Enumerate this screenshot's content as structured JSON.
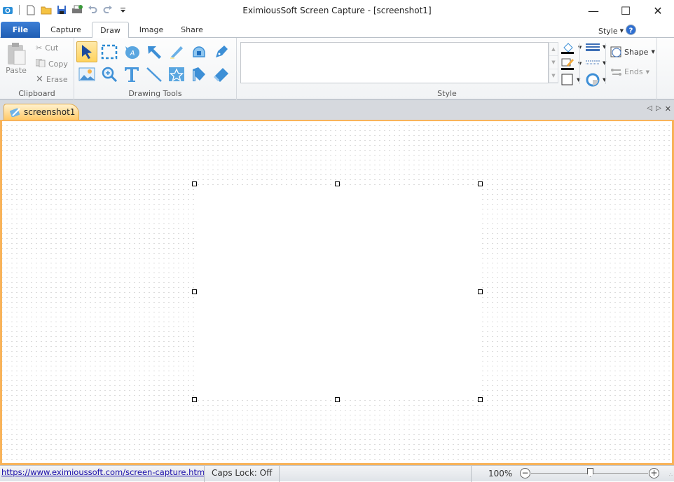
{
  "window": {
    "title": "EximiousSoft Screen Capture - [screenshot1]",
    "controls": [
      "minimize",
      "maximize",
      "close"
    ]
  },
  "quick_access": [
    "camera-icon",
    "new-icon",
    "open-icon",
    "save-icon",
    "print-icon",
    "undo-icon",
    "redo-icon",
    "customize-icon"
  ],
  "menu_tabs": [
    {
      "label": "File",
      "active": false
    },
    {
      "label": "Capture",
      "active": false
    },
    {
      "label": "Draw",
      "active": true
    },
    {
      "label": "Image",
      "active": false
    },
    {
      "label": "Share",
      "active": false
    }
  ],
  "style_menu": {
    "label": "Style"
  },
  "ribbon": {
    "clipboard": {
      "label": "Clipboard",
      "paste": "Paste",
      "cut": "Cut",
      "copy": "Copy",
      "erase": "Erase"
    },
    "drawing_tools": {
      "label": "Drawing Tools",
      "tools": [
        "select",
        "rect-select",
        "callout",
        "arrow",
        "highlighter",
        "fill",
        "pen",
        "image",
        "zoom",
        "text",
        "line",
        "stamp",
        "flag",
        "eraser"
      ],
      "selected": "select"
    },
    "style": {
      "label": "Style"
    },
    "shape": {
      "label": "Shape"
    },
    "ends": {
      "label": "Ends"
    }
  },
  "document_tabs": [
    {
      "label": "screenshot1",
      "active": true
    }
  ],
  "statusbar": {
    "link": "https://www.eximioussoft.com/screen-capture.htm",
    "caps_lock": "Caps Lock: Off",
    "zoom": "100%",
    "zoom_level_percent": 100
  },
  "colors": {
    "accent": "#1f5db3",
    "doc_border": "#f8b35a",
    "selected_tool": "#ffd35e"
  }
}
